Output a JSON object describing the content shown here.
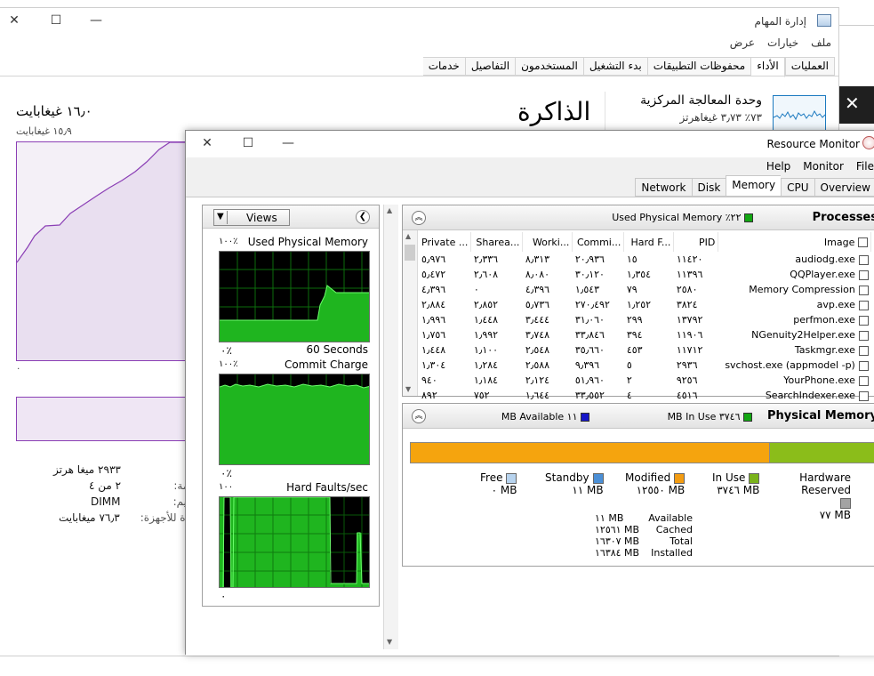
{
  "task_manager": {
    "title": "إدارة المهام",
    "menu": [
      "ملف",
      "خيارات",
      "عرض"
    ],
    "tabs": [
      {
        "label": "العمليات",
        "active": false
      },
      {
        "label": "الأداء",
        "active": true
      },
      {
        "label": "محفوظات التطبيقات",
        "active": false
      },
      {
        "label": "بدء التشغيل",
        "active": false
      },
      {
        "label": "المستخدمون",
        "active": false
      },
      {
        "label": "التفاصيل",
        "active": false
      },
      {
        "label": "خدمات",
        "active": false
      }
    ],
    "cpu_card": {
      "title": "وحدة المعالجة المركزية",
      "subtitle": "٧٣٪ ٣٫٧٣ غيغاهرتز"
    },
    "memory_heading": "الذاكرة",
    "memory_total": "١٦٫٠ غيغابايت",
    "memory_graph_max": "١٥٫٩ غيغابايت",
    "memory_graph_min": "٠",
    "stats": [
      {
        "label": "",
        "value": "٢٩٣٣ ميغا هرتز"
      },
      {
        "label": "ستخدمة:",
        "value": "٢ من ٤"
      },
      {
        "label": "يم:",
        "value": "DIMM"
      },
      {
        "label": "جوزة للأجهزة:",
        "value": "٧٦٫٣ ميغابايت"
      }
    ]
  },
  "resource_monitor": {
    "title": "Resource Monitor",
    "menu": [
      "File",
      "Monitor",
      "Help"
    ],
    "tabs": [
      {
        "label": "Overview",
        "active": false
      },
      {
        "label": "CPU",
        "active": false
      },
      {
        "label": "Memory",
        "active": true
      },
      {
        "label": "Disk",
        "active": false
      },
      {
        "label": "Network",
        "active": false
      }
    ],
    "views_label": "Views",
    "graphs": [
      {
        "title": "Used Physical Memory",
        "top": "١٠٠٪",
        "bottom_left": "٠٪",
        "bottom_right": "60 Seconds"
      },
      {
        "title": "Commit Charge",
        "top": "١٠٠٪",
        "bottom_left": "٠٪",
        "bottom_right": ""
      },
      {
        "title": "Hard Faults/sec",
        "top": "١٠٠",
        "bottom_left": "٠",
        "bottom_right": ""
      }
    ],
    "processes": {
      "title": "Processes",
      "used_physical": "٢٢٪ Used Physical Memory",
      "used_color": "#12a612",
      "columns": [
        "Image",
        "PID",
        "Hard F...",
        "Commi...",
        "Worki...",
        "Sharea...",
        "Private ..."
      ],
      "rows": [
        [
          "audiodg.exe",
          "١١٤٢٠",
          "١٥",
          "٢٠٫٩٣٦",
          "٨٫٣١٣",
          "٢٫٣٣٦",
          "٥٫٩٧٦"
        ],
        [
          "QQPlayer.exe",
          "١١٣٩٦",
          "١٫٣٥٤",
          "٣٠٫١٢٠",
          "٨٫٠٨٠",
          "٢٫٦٠٨",
          "٥٫٤٧٢"
        ],
        [
          "Memory Compression",
          "٢٥٨٠",
          "٧٩",
          "١٫٥٤٣",
          "٤٫٣٩٦",
          "٠",
          "٤٫٣٩٦"
        ],
        [
          "avp.exe",
          "٣٨٢٤",
          "١٫٢٥٢",
          "٢٧٠٫٤٩٢",
          "٥٫٧٣٦",
          "٢٫٨٥٢",
          "٢٫٨٨٤"
        ],
        [
          "perfmon.exe",
          "١٣٧٩٢",
          "٢٩٩",
          "٣١٫٠٦٠",
          "٣٫٤٤٤",
          "١٫٤٤٨",
          "١٫٩٩٦"
        ],
        [
          "NGenuity2Helper.exe",
          "١١٩٠٦",
          "٣٩٤",
          "٣٣٫٨٤٦",
          "٣٫٧٤٨",
          "١٫٩٩٢",
          "١٫٧٥٦"
        ],
        [
          "Taskmgr.exe",
          "١١٧١٢",
          "٤٥٣",
          "٣٥٫٦٦٠",
          "٢٫٥٤٨",
          "١٫١٠٠",
          "١٫٤٤٨"
        ],
        [
          "svchost.exe (appmodel -p)",
          "٢٩٣٦",
          "٥",
          "٩٫٣٩٦",
          "٢٫٥٨٨",
          "١٫٢٨٤",
          "١٫٣٠٤"
        ],
        [
          "YourPhone.exe",
          "٩٢٥٦",
          "٢",
          "٥١٫٩٦٠",
          "٢٫١٢٤",
          "١٫١٨٤",
          "٩٤٠"
        ],
        [
          "SearchIndexer.exe",
          "٤٥١٦",
          "٤",
          "٣٣٫٥٥٢",
          "١٫٦٤٤",
          "٧٥٢",
          "٨٩٢"
        ]
      ]
    },
    "physical_memory": {
      "title": "Physical Memory",
      "in_use": "٣٧٤٦ MB In Use",
      "available": "١١ MB Available",
      "in_use_color": "#12a612",
      "available_color": "#1515c8",
      "bar_segments": [
        {
          "name": "Hardware Reserved",
          "fraction": 0.005,
          "color": "#a3a3a3"
        },
        {
          "name": "In Use",
          "fraction": 0.23,
          "color": "#8bbd1a"
        },
        {
          "name": "Modified",
          "fraction": 0.765,
          "color": "#f5a40e"
        },
        {
          "name": "Standby",
          "fraction": 0.0,
          "color": "#4b8fd6"
        },
        {
          "name": "Free",
          "fraction": 0.0,
          "color": "#b7d3ee"
        }
      ],
      "legend": [
        {
          "name": "Hardware Reserved",
          "value": "٧٧ MB",
          "color": "#a3a3a3"
        },
        {
          "name": "In Use",
          "value": "٣٧٤٦ MB",
          "color": "#7ab31b"
        },
        {
          "name": "Modified",
          "value": "١٢٥٥٠ MB",
          "color": "#f39c12"
        },
        {
          "name": "Standby",
          "value": "١١ MB",
          "color": "#4b8fd6"
        },
        {
          "name": "Free",
          "value": "٠ MB",
          "color": "#b7d3ee"
        }
      ],
      "summary": [
        {
          "label": "Available",
          "value": "١١ MB"
        },
        {
          "label": "Cached",
          "value": "١٢٥٦١ MB"
        },
        {
          "label": "Total",
          "value": "١٦٣٠٧ MB"
        },
        {
          "label": "Installed",
          "value": "١٦٣٨٤ MB"
        }
      ]
    }
  }
}
